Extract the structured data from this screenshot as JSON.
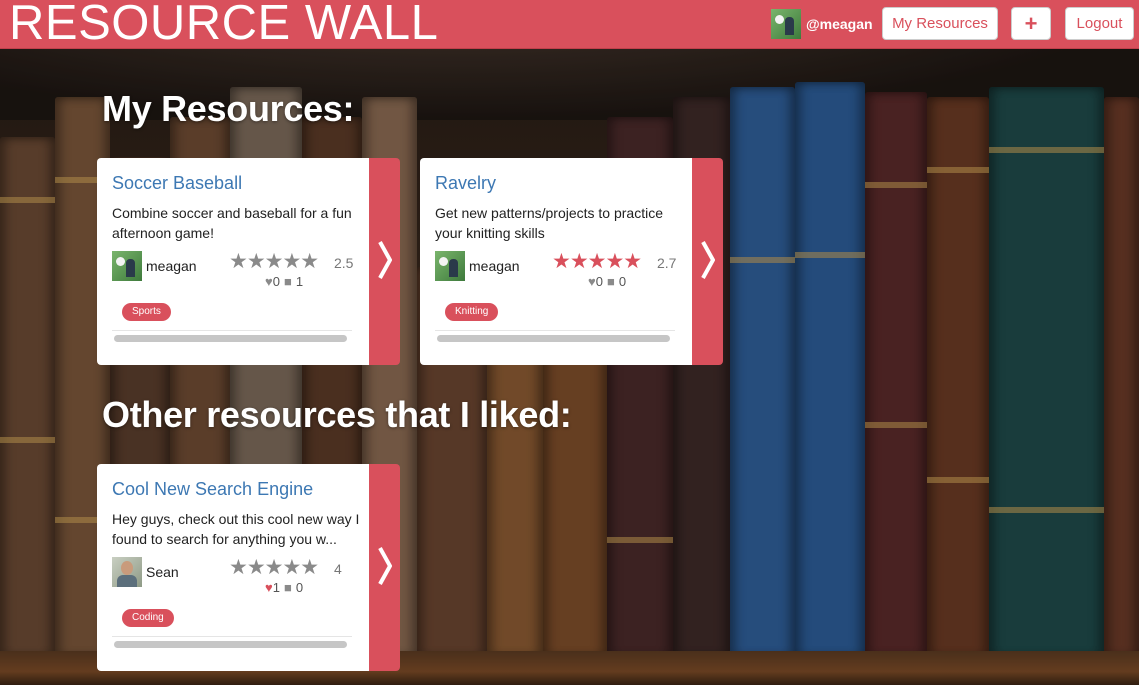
{
  "header": {
    "brand": "RESOURCE WALL",
    "user_handle": "@meagan",
    "my_resources_label": "My Resources",
    "add_label": "+",
    "logout_label": "Logout"
  },
  "sections": {
    "my_resources_title": "My Resources:",
    "liked_title": "Other resources that I liked:"
  },
  "cards": [
    {
      "title": "Soccer Baseball",
      "description": "Combine soccer and baseball for a fun afternoon game!",
      "author": "meagan",
      "stars": "★★★★★",
      "rating": "2.5",
      "likes": "0",
      "comments": "1",
      "liked": false,
      "tag": "Sports"
    },
    {
      "title": "Ravelry",
      "description": "Get new patterns/projects to practice your knitting skills",
      "author": "meagan",
      "stars": "★★★★★",
      "rating": "2.7",
      "likes": "0",
      "comments": "0",
      "liked": false,
      "tag": "Knitting"
    },
    {
      "title": "Cool New Search Engine",
      "description": "Hey guys, check out this cool new way I found to search for anything you w...",
      "author": "Sean",
      "stars": "★★★★★",
      "rating": "4",
      "likes": "1",
      "comments": "0",
      "liked": true,
      "tag": "Coding"
    }
  ],
  "colors": {
    "accent": "#d9505c",
    "link": "#3d78b3",
    "star_gray": "#8a8a8a",
    "star_red": "#d9505c"
  }
}
